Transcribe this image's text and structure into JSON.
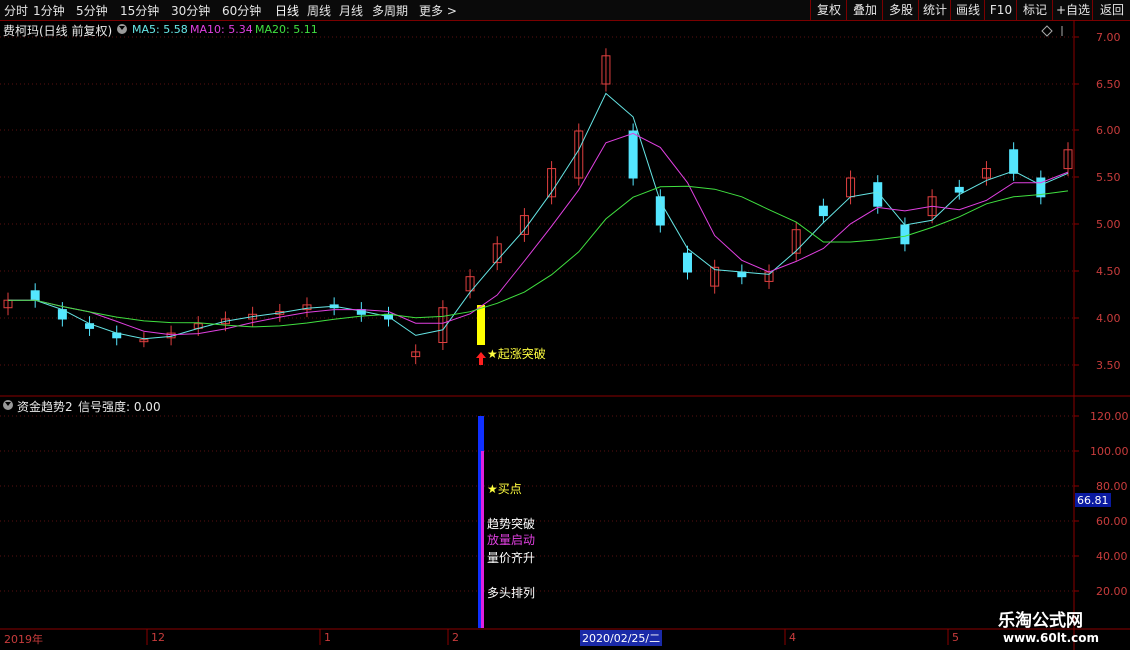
{
  "toolbar": {
    "periods": [
      "分时",
      "1分钟",
      "5分钟",
      "15分钟",
      "30分钟",
      "60分钟",
      "日线",
      "周线",
      "月线",
      "多周期",
      "更多 >"
    ],
    "active": "日线",
    "right_buttons": [
      "复权",
      "叠加",
      "多股",
      "统计",
      "画线",
      "F10",
      "标记",
      "+自选",
      "返回"
    ]
  },
  "main_panel": {
    "title": "费柯玛(日线 前复权)",
    "ma5": "MA5: 5.58",
    "ma10": "MA10: 5.34",
    "ma20": "MA20: 5.11",
    "colors": {
      "ma5": "#66e6e6",
      "ma10": "#e040e0",
      "ma20": "#40e040"
    },
    "y_labels": [
      "7.00",
      "6.50",
      "6.00",
      "5.50",
      "5.00",
      "4.50",
      "4.00",
      "3.50"
    ],
    "signal_label": "★起涨突破"
  },
  "sub_panel": {
    "title": "资金趋势2",
    "strength": "信号强度: 0.00",
    "y_labels": [
      "120.00",
      "100.00",
      "80.00",
      "60.00",
      "40.00",
      "20.00"
    ],
    "current_value": "66.81",
    "labels": {
      "buy_point": "★买点",
      "trend_break": "趋势突破",
      "volume_start": "放量启动",
      "price_volume": "量价齐升",
      "bull_align": "多头排列"
    }
  },
  "x_axis": {
    "labels": [
      "2019年",
      "12",
      "1",
      "2",
      "4",
      "5"
    ],
    "cursor_date": "2020/02/25/二"
  },
  "watermark": {
    "title": "乐淘公式网",
    "url": "www.60lt.com"
  }
}
